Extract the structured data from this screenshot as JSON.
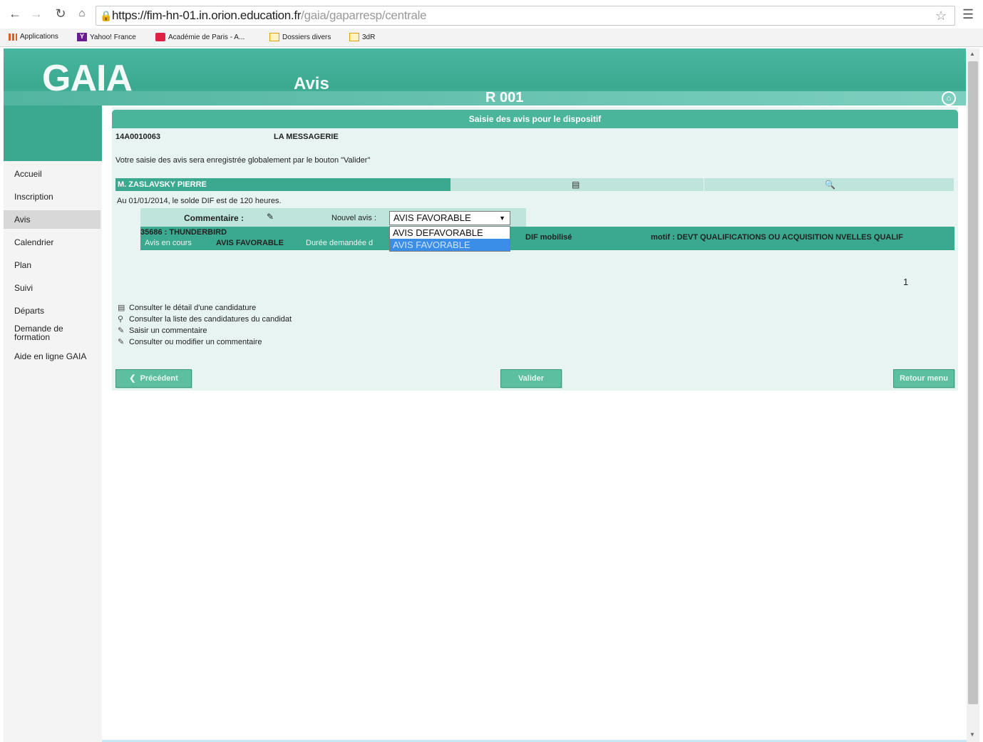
{
  "browser": {
    "url_host": "https://fim-hn-01.in.orion.education.fr",
    "url_path": "/gaia/gaparresp/centrale",
    "bookmarks": [
      "Applications",
      "Yahoo! France",
      "Académie de Paris - A...",
      "Dossiers divers",
      "3dR"
    ]
  },
  "header": {
    "logo": "GAIA",
    "section": "Avis",
    "code": "R 001"
  },
  "sidebar": {
    "items": [
      "Accueil",
      "Inscription",
      "Avis",
      "Calendrier",
      "Plan",
      "Suivi",
      "Départs",
      "Demande de formation",
      "Aide en ligne GAIA"
    ],
    "active": "Avis"
  },
  "main": {
    "title": "Saisie des avis pour le dispositif",
    "dispositif_id": "14A0010063",
    "dispositif_name": "LA MESSAGERIE",
    "notice": "Votre saisie des avis sera enregistrée globalement par le bouton \"Valider\"",
    "candidate": {
      "name": "M. ZASLAVSKY PIERRE",
      "dif_balance": "Au 01/01/2014, le solde DIF est de 120 heures."
    },
    "comment_label": "Commentaire :",
    "new_avis_label": "Nouvel avis :",
    "select_value": "AVIS FAVORABLE",
    "options": [
      "AVIS DEFAVORABLE",
      "AVIS FAVORABLE"
    ],
    "module": "35686 : THUNDERBIRD",
    "current_avis_label": "Avis en cours",
    "current_avis_value": "AVIS FAVORABLE",
    "duration_label": "Durée demandée d",
    "dif_label": "DIF mobilisé",
    "motif": "motif : DEVT QUALIFICATIONS OU ACQUISITION NVELLES QUALIF",
    "page_number": "1",
    "legend": [
      "Consulter le détail d'une candidature",
      "Consulter la liste des candidatures du candidat",
      "Saisir un commentaire",
      "Consulter ou modifier un commentaire"
    ],
    "buttons": {
      "previous": "Précédent",
      "validate": "Valider",
      "back": "Retour menu"
    }
  }
}
